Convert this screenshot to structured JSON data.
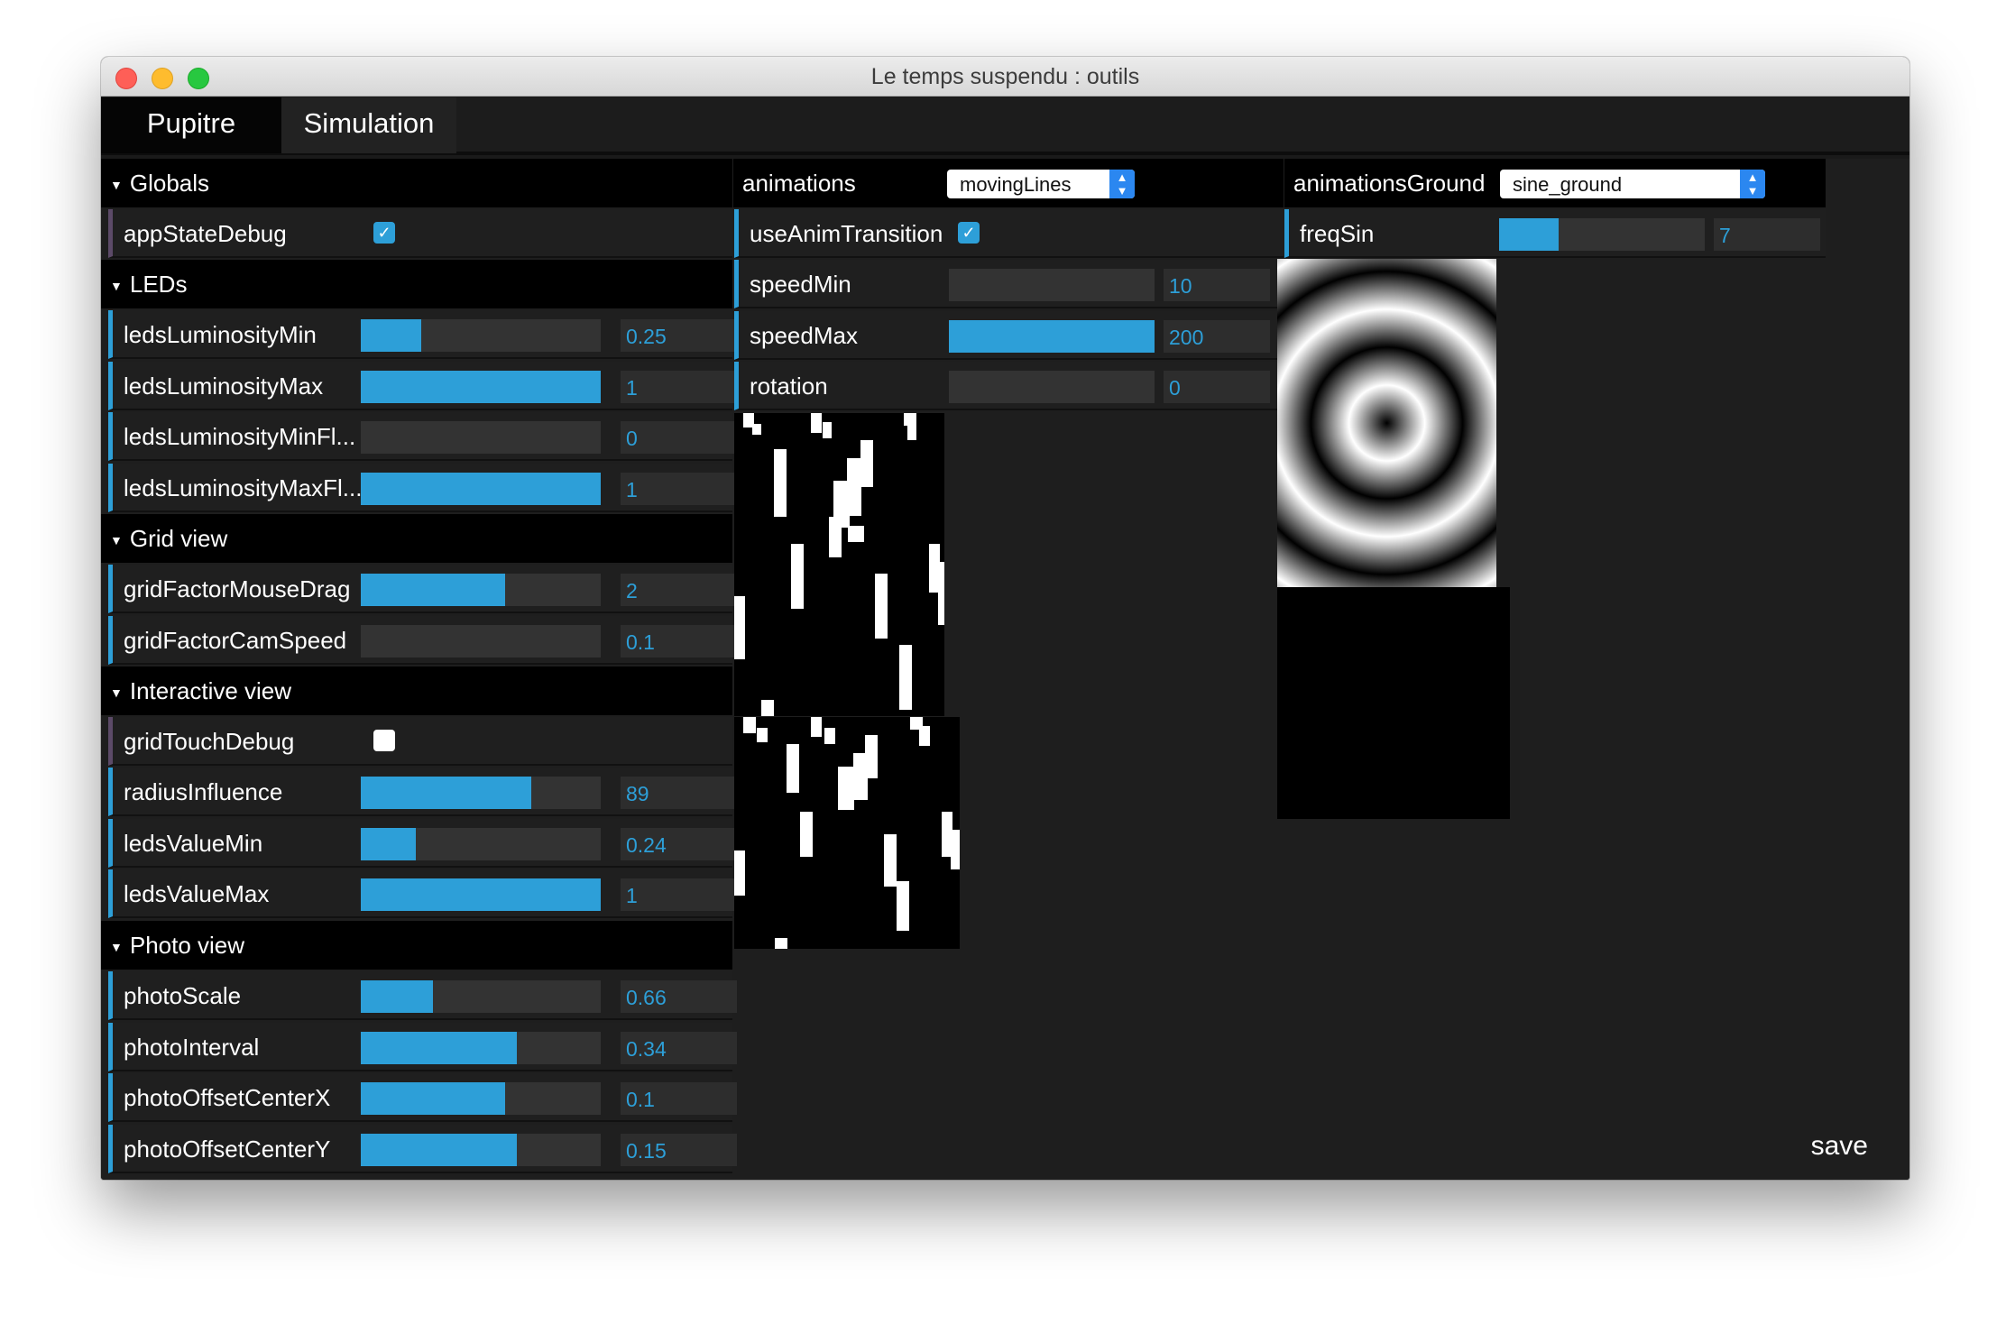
{
  "window": {
    "title": "Le temps suspendu : outils"
  },
  "tabs": [
    "Pupitre",
    "Simulation"
  ],
  "left_panel": {
    "globals": {
      "title": "Globals",
      "appStateDebug": {
        "label": "appStateDebug",
        "checked": true
      }
    },
    "leds": {
      "title": "LEDs",
      "rows": [
        {
          "label": "ledsLuminosityMin",
          "value": "0.25",
          "fill": 0.25
        },
        {
          "label": "ledsLuminosityMax",
          "value": "1",
          "fill": 1.0
        },
        {
          "label": "ledsLuminosityMinFl...",
          "value": "0",
          "fill": 0.0
        },
        {
          "label": "ledsLuminosityMaxFl...",
          "value": "1",
          "fill": 1.0
        }
      ]
    },
    "grid_view": {
      "title": "Grid view",
      "rows": [
        {
          "label": "gridFactorMouseDrag",
          "value": "2",
          "fill": 0.6
        },
        {
          "label": "gridFactorCamSpeed",
          "value": "0.1",
          "fill": 0.0
        }
      ]
    },
    "interactive_view": {
      "title": "Interactive view",
      "gridTouchDebug": {
        "label": "gridTouchDebug",
        "checked": false
      },
      "rows": [
        {
          "label": "radiusInfluence",
          "value": "89",
          "fill": 0.71
        },
        {
          "label": "ledsValueMin",
          "value": "0.24",
          "fill": 0.23
        },
        {
          "label": "ledsValueMax",
          "value": "1",
          "fill": 1.0
        }
      ]
    },
    "photo_view": {
      "title": "Photo view",
      "rows": [
        {
          "label": "photoScale",
          "value": "0.66",
          "fill": 0.3
        },
        {
          "label": "photoInterval",
          "value": "0.34",
          "fill": 0.65
        },
        {
          "label": "photoOffsetCenterX",
          "value": "0.1",
          "fill": 0.6
        },
        {
          "label": "photoOffsetCenterY",
          "value": "0.15",
          "fill": 0.65
        }
      ]
    }
  },
  "middle_panel": {
    "animations_label": "animations",
    "animations_selected": "movingLines",
    "useAnimTransition": {
      "label": "useAnimTransition",
      "checked": true
    },
    "rows": [
      {
        "label": "speedMin",
        "value": "10",
        "fill": 0.0
      },
      {
        "label": "speedMax",
        "value": "200",
        "fill": 1.0
      },
      {
        "label": "rotation",
        "value": "0",
        "fill": 0.0
      }
    ]
  },
  "right_panel": {
    "animationsGround_label": "animationsGround",
    "animationsGround_selected": "sine_ground",
    "freqSin": {
      "label": "freqSin",
      "value": "7",
      "fill": 0.29
    }
  },
  "save_label": "save",
  "colors": {
    "accent": "#2d9fd8",
    "background": "#1e1e1e",
    "section": "#000000"
  },
  "icons": [
    "caret-down-icon",
    "checkmark-icon",
    "dropdown-arrows-icon"
  ]
}
